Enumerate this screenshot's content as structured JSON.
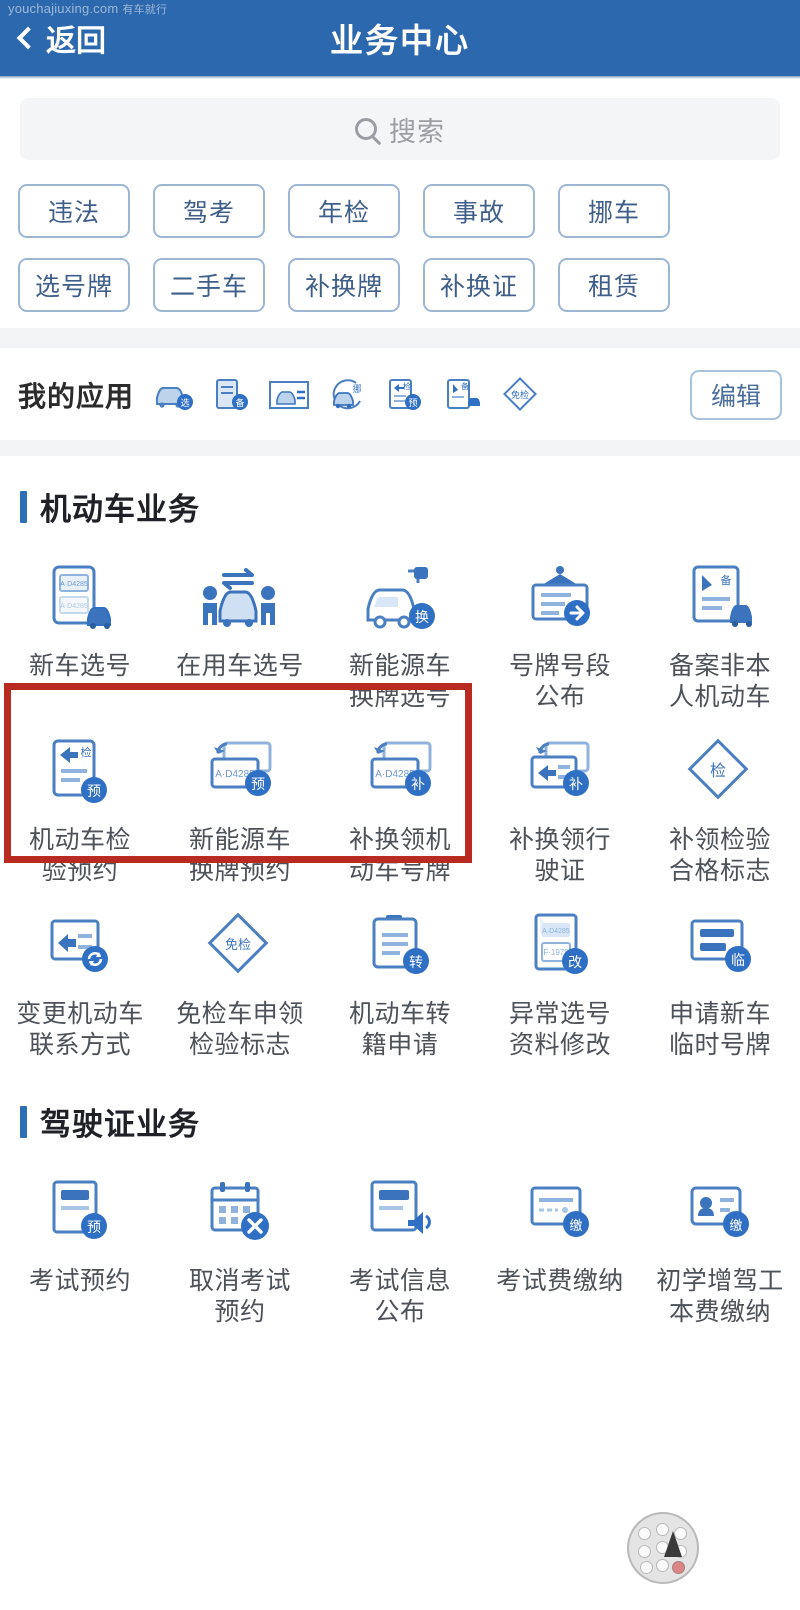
{
  "watermark": {
    "domain": "youchajiuxing.com",
    "cn": "有车就行"
  },
  "header": {
    "back_label": "返回",
    "back_icon": "chevron-left-icon",
    "title": "业务中心",
    "bg_color": "#2C68AD"
  },
  "search": {
    "placeholder": "搜索",
    "icon": "search-icon"
  },
  "chips": [
    {
      "label": "违法"
    },
    {
      "label": "驾考"
    },
    {
      "label": "年检"
    },
    {
      "label": "事故"
    },
    {
      "label": "挪车"
    },
    {
      "label": "选号牌"
    },
    {
      "label": "二手车"
    },
    {
      "label": "补换牌"
    },
    {
      "label": "补换证"
    },
    {
      "label": "租赁"
    }
  ],
  "my_apps": {
    "label": "我的应用",
    "edit_label": "编辑",
    "icons": [
      {
        "name": "car-plate-select-icon"
      },
      {
        "name": "document-record-icon"
      },
      {
        "name": "plate-photo-icon"
      },
      {
        "name": "move-car-icon"
      },
      {
        "name": "inspection-appointment-icon"
      },
      {
        "name": "record-nonlocal-vehicle-icon"
      },
      {
        "name": "exempt-inspection-icon"
      }
    ]
  },
  "sections": [
    {
      "title": "机动车业务",
      "accent_color": "#2C6FB5",
      "items": [
        {
          "label": "新车选号",
          "icon": "new-car-plate-select-icon"
        },
        {
          "label": "在用车选号",
          "icon": "in-use-car-plate-select-icon"
        },
        {
          "label": "新能源车\n换牌选号",
          "icon": "new-energy-plate-change-icon"
        },
        {
          "label": "号牌号段\n公布",
          "icon": "plate-range-announce-icon"
        },
        {
          "label": "备案非本\n人机动车",
          "icon": "record-nonlocal-vehicle-icon"
        },
        {
          "label": "机动车检\n验预约",
          "icon": "vehicle-inspection-appointment-icon"
        },
        {
          "label": "新能源车\n换牌预约",
          "icon": "new-energy-plate-appointment-icon"
        },
        {
          "label": "补换领机\n动车号牌",
          "icon": "replace-vehicle-plate-icon"
        },
        {
          "label": "补换领行\n驶证",
          "icon": "replace-driving-license-icon"
        },
        {
          "label": "补领检验\n合格标志",
          "icon": "replace-inspection-mark-icon"
        },
        {
          "label": "变更机动车\n联系方式",
          "icon": "change-contact-info-icon"
        },
        {
          "label": "免检车申领\n检验标志",
          "icon": "exempt-inspection-mark-icon"
        },
        {
          "label": "机动车转\n籍申请",
          "icon": "vehicle-transfer-icon"
        },
        {
          "label": "异常选号\n资料修改",
          "icon": "abnormal-plate-data-edit-icon"
        },
        {
          "label": "申请新车\n临时号牌",
          "icon": "temporary-plate-apply-icon"
        }
      ]
    },
    {
      "title": "驾驶证业务",
      "accent_color": "#2C6FB5",
      "items": [
        {
          "label": "考试预约",
          "icon": "exam-appointment-icon"
        },
        {
          "label": "取消考试\n预约",
          "icon": "cancel-exam-appointment-icon"
        },
        {
          "label": "考试信息\n公布",
          "icon": "exam-info-announce-icon"
        },
        {
          "label": "考试费缴纳",
          "icon": "exam-fee-payment-icon"
        },
        {
          "label": "初学增驾工\n本费缴纳",
          "icon": "license-fee-payment-icon"
        }
      ]
    }
  ],
  "highlight": {
    "color": "#B92B20",
    "covers": [
      "新车选号",
      "在用车选号",
      "新能源车换牌选号"
    ]
  },
  "assistive_touch": {
    "name": "floating-assistive-touch"
  },
  "plate_sample_text": "A·D4285",
  "badges": {
    "yu": "预",
    "bu": "补",
    "huan": "换",
    "jian": "检",
    "zhuan": "转",
    "gai": "改",
    "lin": "临",
    "jiao": "缴",
    "bei": "备",
    "mianjian": "免检"
  }
}
